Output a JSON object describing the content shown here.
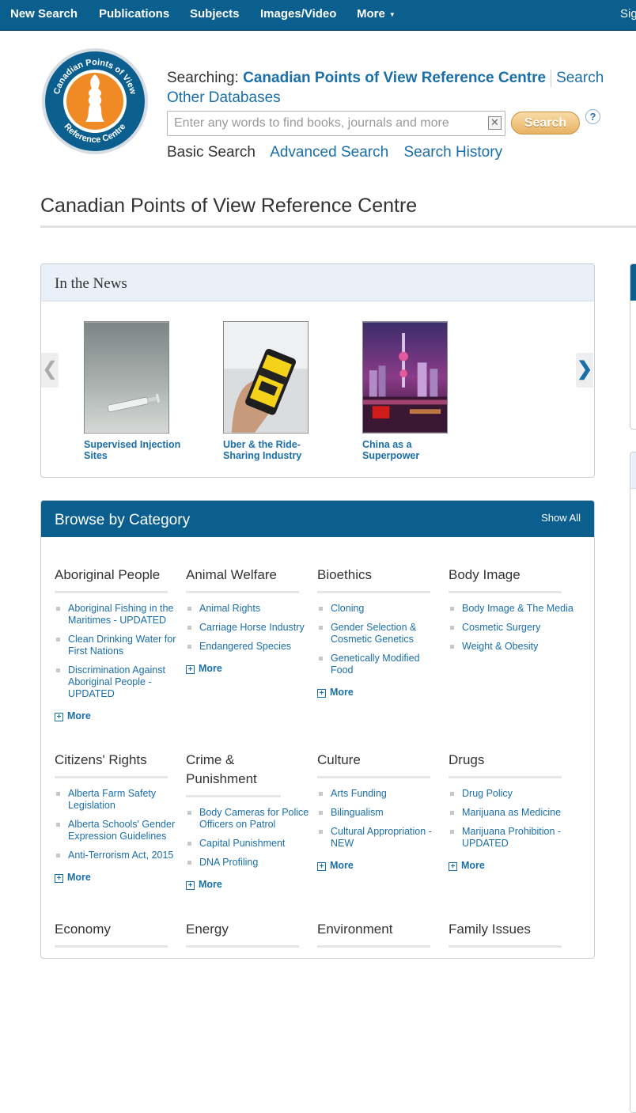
{
  "nav": {
    "items": [
      "New Search",
      "Publications",
      "Subjects",
      "Images/Video",
      "More",
      "Sig"
    ]
  },
  "logo": {
    "ring_top": "Canadian Points of View",
    "ring_bottom": "Reference Centre"
  },
  "search": {
    "searching_label": "Searching:",
    "database": "Canadian Points of View Reference Centre",
    "other_db_link": "Search Other Databases",
    "placeholder": "Enter any words to find books, journals and more",
    "button": "Search",
    "help": "?",
    "basic": "Basic Search",
    "advanced": "Advanced Search",
    "history": "Search History"
  },
  "page_title": "Canadian Points of View Reference Centre",
  "news": {
    "heading": "In the News",
    "items": [
      {
        "label": "Supervised Injection Sites"
      },
      {
        "label": "Uber & the Ride-Sharing Industry"
      },
      {
        "label": "China as a Superpower"
      }
    ]
  },
  "browse": {
    "heading": "Browse by Category",
    "show_all": "Show All",
    "more_label": "More",
    "categories": [
      {
        "title": "Aboriginal People",
        "items": [
          "Aboriginal Fishing in the Maritimes - UPDATED",
          "Clean Drinking Water for First Nations",
          "Discrimination Against Aboriginal People - UPDATED"
        ]
      },
      {
        "title": "Animal Welfare",
        "items": [
          "Animal Rights",
          "Carriage Horse Industry",
          "Endangered Species"
        ]
      },
      {
        "title": "Bioethics",
        "items": [
          "Cloning",
          "Gender Selection & Cosmetic Genetics",
          "Genetically Modified Food"
        ]
      },
      {
        "title": "Body Image",
        "items": [
          "Body Image & The Media",
          "Cosmetic Surgery",
          "Weight & Obesity"
        ]
      },
      {
        "title": "Citizens' Rights",
        "items": [
          "Alberta Farm Safety Legislation",
          "Alberta Schools' Gender Expression Guidelines",
          "Anti-Terrorism Act, 2015"
        ]
      },
      {
        "title": "Crime & Punishment",
        "items": [
          "Body Cameras for Police Officers on Patrol",
          "Capital Punishment",
          "DNA Profiling"
        ]
      },
      {
        "title": "Culture",
        "items": [
          "Arts Funding",
          "Bilingualism",
          "Cultural Appropriation - NEW"
        ]
      },
      {
        "title": "Drugs",
        "items": [
          "Drug Policy",
          "Marijuana as Medicine",
          "Marijuana Prohibition - UPDATED"
        ]
      },
      {
        "title": "Economy",
        "items": []
      },
      {
        "title": "Energy",
        "items": []
      },
      {
        "title": "Environment",
        "items": []
      },
      {
        "title": "Family Issues",
        "items": []
      }
    ]
  },
  "colors": {
    "nav_bg": "#0b5f8f",
    "link": "#1a6fa8",
    "logo_orange": "#f08a24",
    "logo_blue": "#0b5f8f",
    "search_button": "#e8b263"
  }
}
